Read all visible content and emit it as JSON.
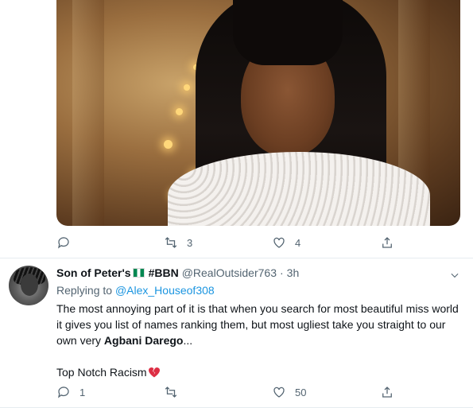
{
  "tweet1": {
    "actions": {
      "reply_count": "",
      "retweet_count": "3",
      "like_count": "4"
    }
  },
  "tweet2": {
    "display_name": "Son of Peter's",
    "flag_emoji": "nigeria-flag",
    "hashtag": "#BBN",
    "handle": "@RealOutsider763",
    "separator": "·",
    "time": "3h",
    "replying_to_label": "Replying to",
    "replying_to_handle": "@Alex_Houseof308",
    "text_part1": "The most annoying part of it is that when you search for most beautiful miss world it gives you list of names ranking them, but most ugliest take you straight to our own very ",
    "text_bold": "Agbani Darego",
    "text_part2": "...",
    "text_line2": "Top Notch Racism",
    "text_emoji": "broken-heart",
    "actions": {
      "reply_count": "1",
      "retweet_count": "",
      "like_count": "50"
    }
  },
  "colors": {
    "link": "#1b95e0",
    "muted": "#536471",
    "text": "#0f1419",
    "divider": "#e6ecf0"
  }
}
